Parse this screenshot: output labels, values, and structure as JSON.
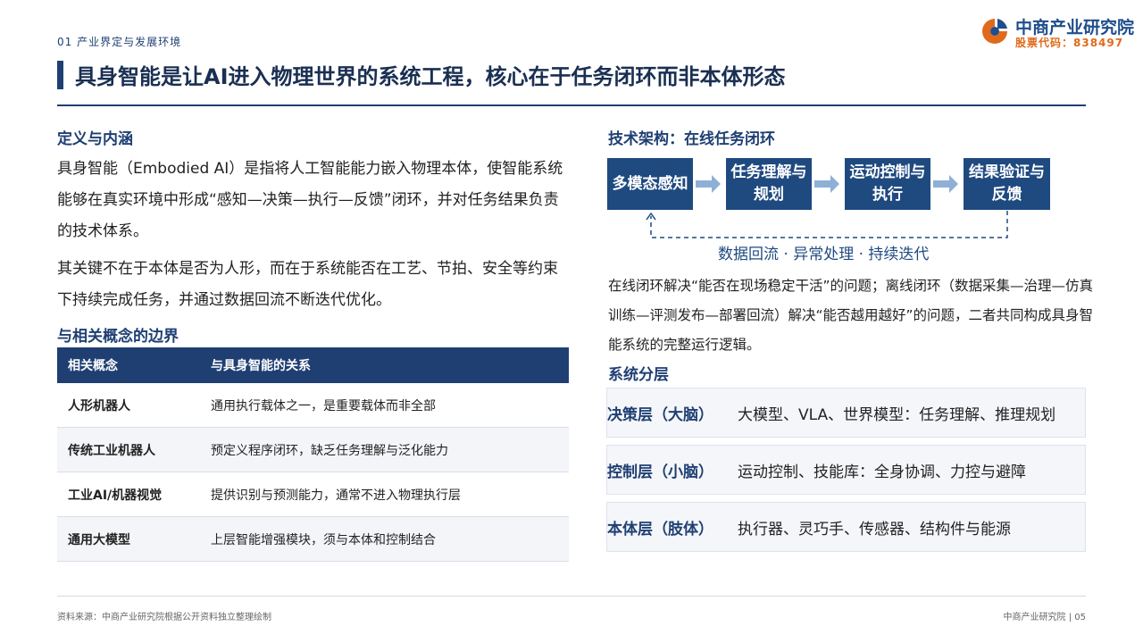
{
  "header": {
    "section_tag": "01 产业界定与发展环境",
    "title": "具身智能是让AI进入物理世界的系统工程，核心在于任务闭环而非本体形态",
    "logo_name": "中商产业研究院",
    "logo_code": "股票代码：838497"
  },
  "left": {
    "definition_heading": "定义与内涵",
    "para1": "具身智能（Embodied AI）是指将人工智能能力嵌入物理本体，使智能系统能够在真实环境中形成“感知—决策—执行—反馈”闭环，并对任务结果负责的技术体系。",
    "para2": "其关键不在于本体是否为人形，而在于系统能否在工艺、节拍、安全等约束下持续完成任务，并通过数据回流不断迭代优化。",
    "boundary_heading": "与相关概念的边界",
    "table": {
      "headers": [
        "相关概念",
        "与具身智能的关系"
      ],
      "rows": [
        [
          "人形机器人",
          "通用执行载体之一，是重要载体而非全部"
        ],
        [
          "传统工业机器人",
          "预定义程序闭环，缺乏任务理解与泛化能力"
        ],
        [
          "工业AI/机器视觉",
          "提供识别与预测能力，通常不进入物理执行层"
        ],
        [
          "通用大模型",
          "上层智能增强模块，须与本体和控制结合"
        ]
      ]
    }
  },
  "right": {
    "arch_heading": "技术架构：在线任务闭环",
    "flow": [
      "多模态感知",
      "任务理解与规划",
      "运动控制与执行",
      "结果验证与反馈"
    ],
    "loop_label": "数据回流 · 异常处理 · 持续迭代",
    "loop_desc": "在线闭环解决“能否在现场稳定干活”的问题；离线闭环（数据采集—治理—仿真训练—评测发布—部署回流）解决“能否越用越好”的问题，二者共同构成具身智能系统的完整运行逻辑。",
    "layers_heading": "系统分层",
    "layers": [
      {
        "name": "决策层（大脑）",
        "desc": "大模型、VLA、世界模型：任务理解、推理规划"
      },
      {
        "name": "控制层（小脑）",
        "desc": "运动控制、技能库：全身协调、力控与避障"
      },
      {
        "name": "本体层（肢体）",
        "desc": "执行器、灵巧手、传感器、结构件与能源"
      }
    ]
  },
  "footer": {
    "source": "资料来源：中商产业研究院根据公开资料独立整理绘制",
    "right": "中商产业研究院 | 05"
  },
  "colors": {
    "navy": "#1f3f73",
    "box_blue": "#1f4a80",
    "arrow_blue": "#8fb0d6",
    "accent_orange": "#e06a1b"
  },
  "icons": {
    "logo": "company-logo-icon",
    "arrow": "arrow-right-icon"
  }
}
